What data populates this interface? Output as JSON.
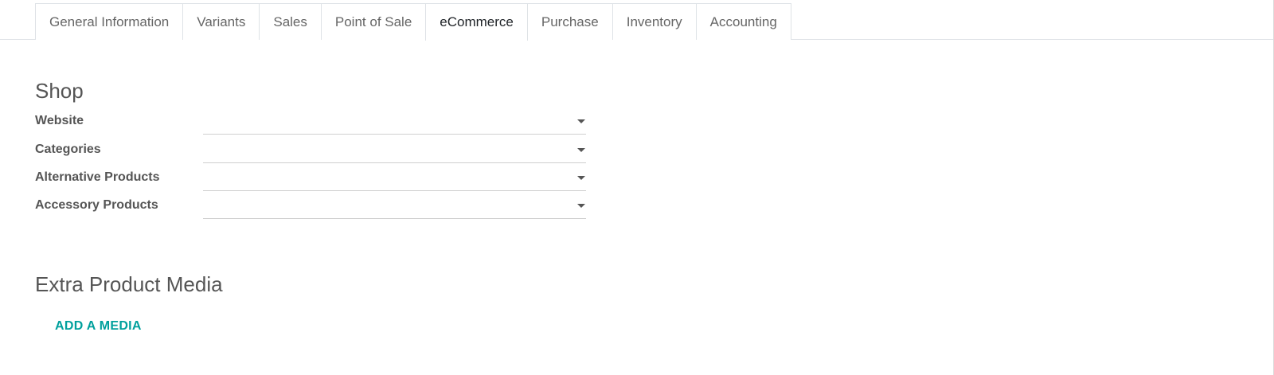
{
  "tabs": [
    {
      "label": "General Information"
    },
    {
      "label": "Variants"
    },
    {
      "label": "Sales"
    },
    {
      "label": "Point of Sale"
    },
    {
      "label": "eCommerce",
      "active": true
    },
    {
      "label": "Purchase"
    },
    {
      "label": "Inventory"
    },
    {
      "label": "Accounting"
    }
  ],
  "shop": {
    "title": "Shop",
    "fields": [
      {
        "label": "Website",
        "value": ""
      },
      {
        "label": "Categories",
        "value": ""
      },
      {
        "label": "Alternative Products",
        "value": ""
      },
      {
        "label": "Accessory Products",
        "value": ""
      }
    ]
  },
  "media": {
    "title": "Extra Product Media",
    "add_label": "ADD A MEDIA"
  },
  "colors": {
    "accent": "#00a09d",
    "text": "#555555"
  }
}
